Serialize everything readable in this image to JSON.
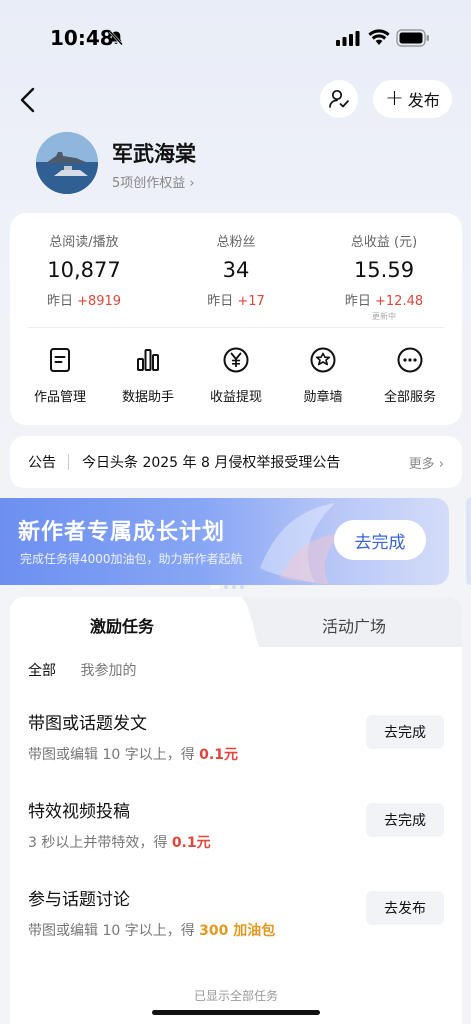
{
  "status_bar": {
    "time": "10:48"
  },
  "nav": {
    "publish_label": "发布"
  },
  "profile": {
    "name": "军武海棠",
    "subtitle": "5项创作权益 ›"
  },
  "stats": [
    {
      "label": "总阅读/播放",
      "value": "10,877",
      "delta_prefix": "昨日 ",
      "delta": "+8919",
      "note": ""
    },
    {
      "label": "总粉丝",
      "value": "34",
      "delta_prefix": "昨日 ",
      "delta": "+17",
      "note": ""
    },
    {
      "label": "总收益 (元)",
      "value": "15.59",
      "delta_prefix": "昨日 ",
      "delta": "+12.48",
      "note": "更新中"
    }
  ],
  "services": [
    {
      "label": "作品管理",
      "icon": "document-icon"
    },
    {
      "label": "数据助手",
      "icon": "bar-chart-icon"
    },
    {
      "label": "收益提现",
      "icon": "yen-icon"
    },
    {
      "label": "勋章墙",
      "icon": "medal-icon"
    },
    {
      "label": "全部服务",
      "icon": "more-icon"
    }
  ],
  "notice": {
    "tag": "公告",
    "text": "今日头条 2025 年 8 月侵权举报受理公告",
    "more": "更多 ›"
  },
  "banner": {
    "title": "新作者专属成长计划",
    "subtitle": "完成任务得4000加油包，助力新作者起航",
    "button": "去完成"
  },
  "tasks": {
    "tabs": [
      "激励任务",
      "活动广场"
    ],
    "filters": [
      "全部",
      "我参加的"
    ],
    "items": [
      {
        "title": "带图或话题发文",
        "desc": "带图或编辑 10 字以上，得 ",
        "reward": "0.1元",
        "reward_color": "#e0463c",
        "button": "去完成"
      },
      {
        "title": "特效视频投稿",
        "desc": "3 秒以上并带特效，得 ",
        "reward": "0.1元",
        "reward_color": "#e0463c",
        "button": "去完成"
      },
      {
        "title": "参与话题讨论",
        "desc": "带图或编辑 10 字以上，得 ",
        "reward": "300 加油包",
        "reward_color": "#e49a20",
        "button": "去发布"
      }
    ],
    "footer": "已显示全部任务"
  }
}
